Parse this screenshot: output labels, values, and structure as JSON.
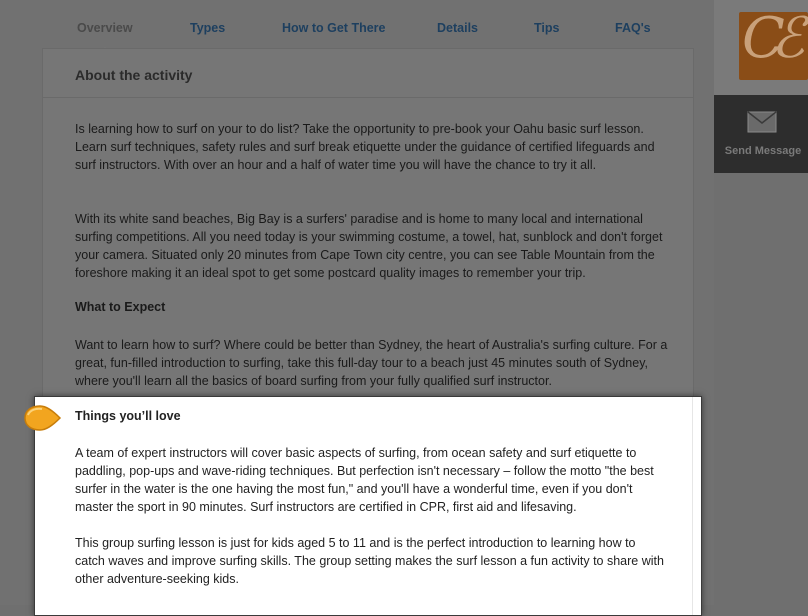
{
  "tabs": [
    {
      "label": "Overview",
      "active": true
    },
    {
      "label": "Types"
    },
    {
      "label": "How to Get There"
    },
    {
      "label": "Details"
    },
    {
      "label": "Tips"
    },
    {
      "label": "FAQ's"
    }
  ],
  "card": {
    "title": "About the activity",
    "paragraphs": [
      "Is learning how to surf on your to do list? Take the opportunity to pre-book your Oahu basic surf lesson. Learn surf techniques, safety rules and surf break etiquette under the guidance of certified lifeguards and surf instructors. With over an hour and a half of water time you will have the chance to try it all.",
      "With its white sand beaches, Big Bay is a surfers' paradise and is home to many local and international surfing competitions. All you need today is your swimming costume, a towel, hat, sunblock and don't forget your camera. Situated only 20 minutes from Cape Town city centre, you can see Table Mountain from the foreshore making it an ideal spot to get some postcard quality images to remember your trip."
    ],
    "what_to_expect": {
      "heading": "What to Expect",
      "text": "Want to learn how to surf? Where could be better than Sydney, the heart of Australia's surfing culture. For a great, fun-filled introduction to surfing, take this full-day tour to a beach just 45 minutes south of Sydney, where you'll learn all the basics of board surfing from your fully qualified surf instructor."
    }
  },
  "highlight": {
    "heading": "Things you’ll love",
    "paragraphs": [
      "A team of expert instructors will cover basic aspects of surfing, from ocean safety and surf etiquette to paddling, pop-ups and wave-riding techniques. But perfection isn't necessary – follow the motto \"the best surfer in the water is the one having the most fun,\" and you'll have a wonderful time, even if you don't master the sport in 90 minutes. Surf instructors are certified in CPR, first aid and lifesaving.",
      "This group surfing lesson is just for kids aged 5 to 11 and is the perfect introduction to learning how to catch waves and improve surfing skills. The group setting makes the surf lesson a fun activity to share with other adventure-seeking kids."
    ]
  },
  "sidebar": {
    "logo_icon": "ce-logo",
    "send_message_label": "Send Message",
    "send_icon": "envelope-icon"
  },
  "colors": {
    "overlay": "#717171",
    "tab_text": "#1d3f5f",
    "marker": "#f2a51f",
    "send_box": "#2d2d2d"
  }
}
